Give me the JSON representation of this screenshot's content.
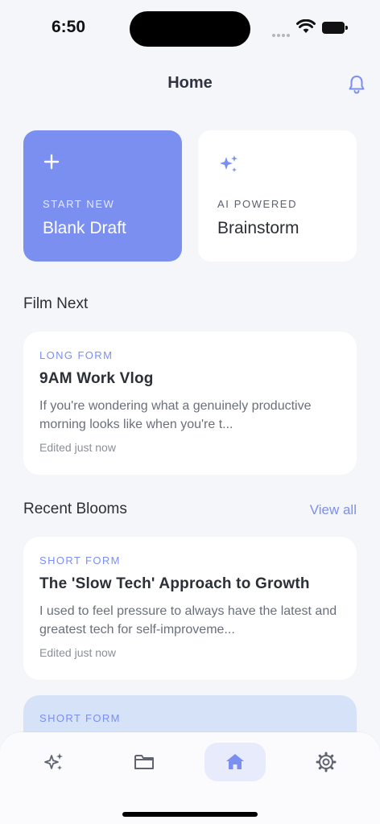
{
  "status": {
    "time": "6:50"
  },
  "header": {
    "title": "Home"
  },
  "actions": [
    {
      "eyebrow": "START NEW",
      "title": "Blank Draft",
      "icon": "plus-icon"
    },
    {
      "eyebrow": "AI POWERED",
      "title": "Brainstorm",
      "icon": "sparkles-icon"
    }
  ],
  "film_next": {
    "heading": "Film Next",
    "card": {
      "type": "LONG FORM",
      "title": "9AM Work Vlog",
      "excerpt": "If you're wondering what a genuinely productive morning looks like when you're t...",
      "meta": "Edited just now"
    }
  },
  "recent": {
    "heading": "Recent Blooms",
    "view_all": "View all",
    "items": [
      {
        "type": "SHORT FORM",
        "title": "The 'Slow Tech' Approach to Growth",
        "excerpt": "I used to feel pressure to always have the latest and greatest tech for self-improveme...",
        "meta": "Edited just now"
      },
      {
        "type": "SHORT FORM"
      }
    ]
  },
  "nav": {
    "items": [
      {
        "icon": "sparkles-icon",
        "active": false
      },
      {
        "icon": "folder-icon",
        "active": false
      },
      {
        "icon": "home-icon",
        "active": true
      },
      {
        "icon": "gear-icon",
        "active": false
      }
    ]
  },
  "colors": {
    "accent": "#7b8ff0",
    "background": "#f5f6fa",
    "active_nav_bg": "#e8ebfc",
    "peek_card_bg": "#d6e2f7"
  }
}
